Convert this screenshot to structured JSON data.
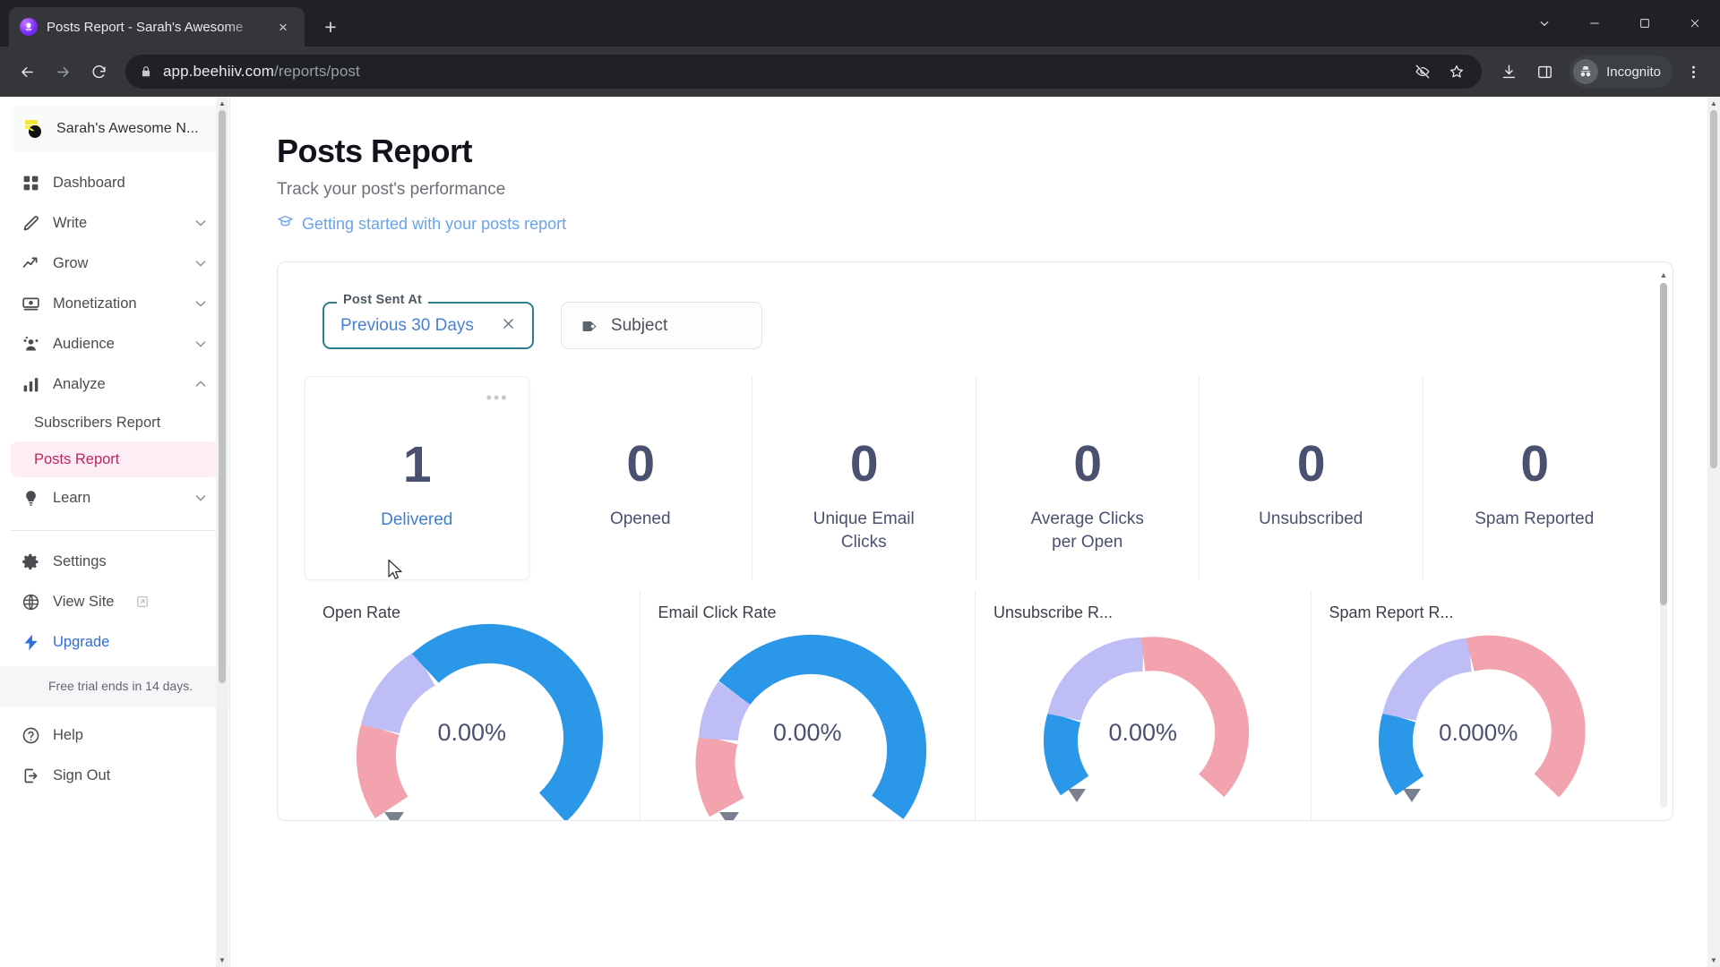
{
  "browser": {
    "tab": {
      "title": "Posts Report - Sarah's Awesome ",
      "favicon": "beehiiv-favicon-icon",
      "close": "×"
    },
    "newtab_label": "+",
    "window": {
      "minimize": "−",
      "maximize": "▭",
      "close": "✕",
      "chevron": "⌄"
    },
    "nav": {
      "back": "back-arrow-icon",
      "forward": "forward-arrow-icon",
      "reload": "reload-icon"
    },
    "address": {
      "lock": "lock-icon",
      "domain": "app.beehiiv.com",
      "path": "/reports/post"
    },
    "actions": {
      "eye_off": "eye-off-icon",
      "bookmark": "star-icon",
      "download": "download-icon",
      "sidepanel": "side-panel-icon",
      "profile_label": "Incognito",
      "menu": "kebab-menu-icon"
    }
  },
  "sidebar": {
    "workspace": "Sarah's Awesome N...",
    "items": [
      {
        "label": "Dashboard",
        "icon": "grid-icon",
        "expandable": false
      },
      {
        "label": "Write",
        "icon": "pencil-icon",
        "expandable": true,
        "chev": "down"
      },
      {
        "label": "Grow",
        "icon": "trend-up-icon",
        "expandable": true,
        "chev": "down"
      },
      {
        "label": "Monetization",
        "icon": "money-icon",
        "expandable": true,
        "chev": "down"
      },
      {
        "label": "Audience",
        "icon": "people-icon",
        "expandable": true,
        "chev": "down"
      },
      {
        "label": "Analyze",
        "icon": "bar-chart-icon",
        "expandable": true,
        "chev": "up"
      }
    ],
    "subitems": [
      {
        "label": "Subscribers Report",
        "active": false
      },
      {
        "label": "Posts Report",
        "active": true
      }
    ],
    "learn": {
      "label": "Learn",
      "icon": "lightbulb-icon",
      "chev": "down"
    },
    "footer": [
      {
        "label": "Settings",
        "icon": "gear-icon",
        "external": false
      },
      {
        "label": "View Site",
        "icon": "globe-icon",
        "external": true
      },
      {
        "label": "Upgrade",
        "icon": "bolt-icon",
        "external": false,
        "accent": true
      }
    ],
    "trial_notice": "Free trial ends in 14 days.",
    "bottom": [
      {
        "label": "Help",
        "icon": "help-circle-icon"
      },
      {
        "label": "Sign Out",
        "icon": "sign-out-icon"
      }
    ],
    "accent_pink": "#c2255c",
    "accent_blue": "#2f6fde"
  },
  "main": {
    "title": "Posts Report",
    "subtitle": "Track your post's performance",
    "help_link": "Getting started with your posts report",
    "help_icon": "graduation-cap-icon",
    "filters": {
      "date": {
        "legend": "Post Sent At",
        "value": "Previous 30 Days",
        "clear": "×"
      },
      "subject": {
        "icon": "tag-icon",
        "label": "Subject"
      }
    },
    "metrics": [
      {
        "value": "1",
        "label": "Delivered",
        "hovered": true,
        "menu": "•••"
      },
      {
        "value": "0",
        "label": "Opened",
        "hovered": false
      },
      {
        "value": "0",
        "label": "Unique Email Clicks",
        "hovered": false
      },
      {
        "value": "0",
        "label": "Average Clicks per Open",
        "hovered": false
      },
      {
        "value": "0",
        "label": "Unsubscribed",
        "hovered": false
      },
      {
        "value": "0",
        "label": "Spam Reported",
        "hovered": false
      }
    ]
  },
  "chart_data": [
    {
      "type": "pie",
      "title": "Open Rate",
      "value": 0,
      "value_label": "0.00%",
      "unit": "%",
      "needle_position_deg": -120,
      "segments": [
        {
          "name": "low",
          "color": "#f2a3ad",
          "sweep_deg": 66
        },
        {
          "name": "mid",
          "color": "#bfbdf5",
          "sweep_deg": 54
        },
        {
          "name": "high",
          "color": "#2b97e8",
          "sweep_deg": 180
        }
      ]
    },
    {
      "type": "pie",
      "title": "Email Click Rate",
      "value": 0,
      "value_label": "0.00%",
      "unit": "%",
      "needle_position_deg": -120,
      "segments": [
        {
          "name": "low",
          "color": "#f2a3ad",
          "sweep_deg": 40
        },
        {
          "name": "mid",
          "color": "#bfbdf5",
          "sweep_deg": 40
        },
        {
          "name": "high",
          "color": "#2b97e8",
          "sweep_deg": 220
        }
      ]
    },
    {
      "type": "pie",
      "title": "Unsubscribe R...",
      "value": 0,
      "value_label": "0.00%",
      "unit": "%",
      "needle_position_deg": -118,
      "segments": [
        {
          "name": "high",
          "color": "#2b97e8",
          "sweep_deg": 60
        },
        {
          "name": "mid",
          "color": "#bfbdf5",
          "sweep_deg": 90
        },
        {
          "name": "low",
          "color": "#f2a3ad",
          "sweep_deg": 150
        }
      ]
    },
    {
      "type": "pie",
      "title": "Spam Report R...",
      "value": 0,
      "value_label": "0.000%",
      "unit": "%",
      "needle_position_deg": -118,
      "segments": [
        {
          "name": "high",
          "color": "#2b97e8",
          "sweep_deg": 60
        },
        {
          "name": "mid",
          "color": "#bfbdf5",
          "sweep_deg": 84
        },
        {
          "name": "low",
          "color": "#f2a3ad",
          "sweep_deg": 156
        }
      ]
    }
  ]
}
